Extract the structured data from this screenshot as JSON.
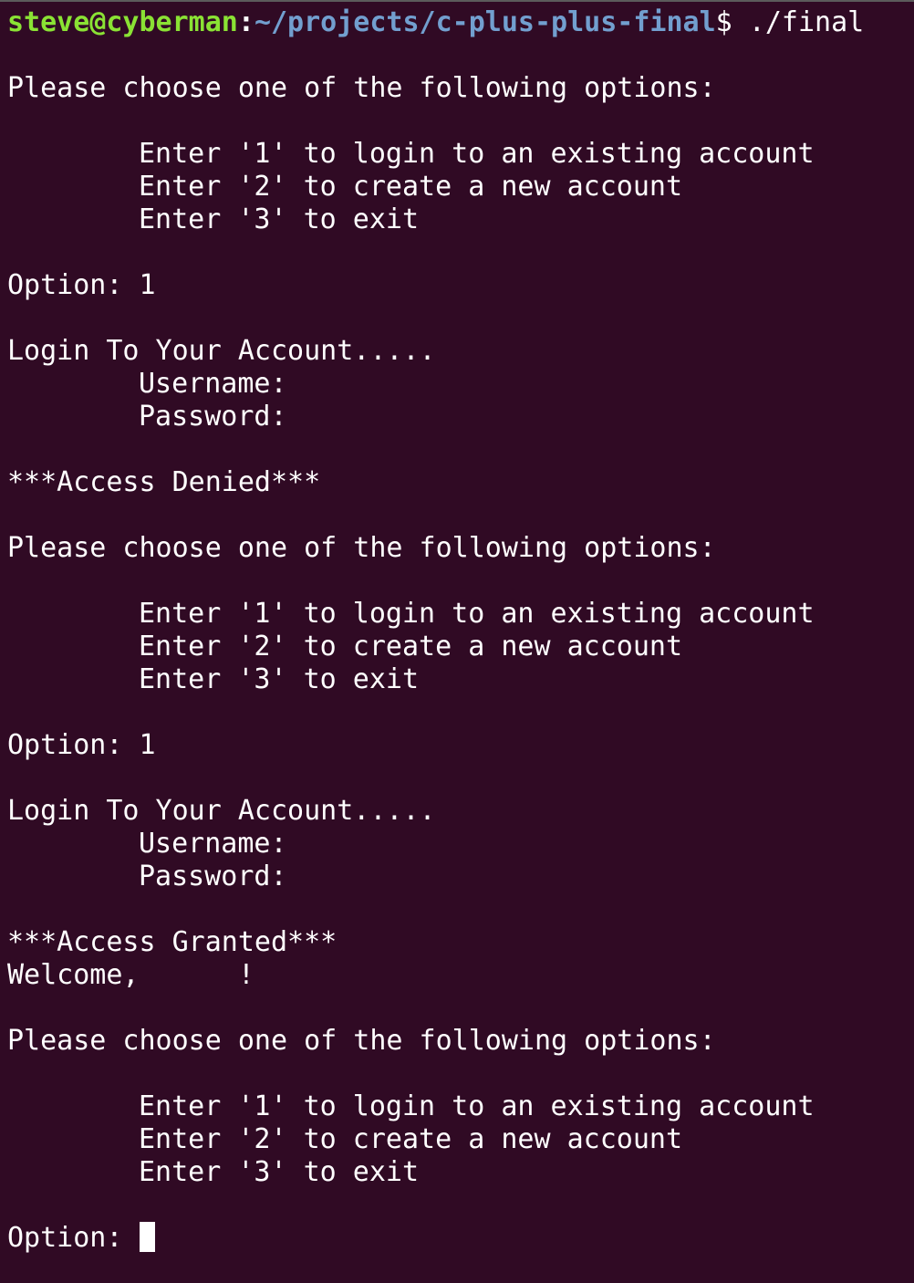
{
  "prompt": {
    "user_host": "steve@cyberman",
    "separator": ":",
    "path": "~/projects/c-plus-plus-final",
    "symbol": "$ ",
    "command": "./final"
  },
  "menu": {
    "header": "Please choose one of the following options:",
    "option1": "Enter '1' to login to an existing account",
    "option2": "Enter '2' to create a new account",
    "option3": "Enter '3' to exit"
  },
  "blocks": [
    {
      "option_line": "Option: 1"
    },
    {
      "option_line": "Option: 1"
    }
  ],
  "login": {
    "title": "Login To Your Account.....",
    "username": "Username:",
    "password": "Password:"
  },
  "results": {
    "denied": "***Access Denied***",
    "granted": "***Access Granted***",
    "welcome": "Welcome,      !"
  },
  "final_prompt": "Option: ",
  "colors": {
    "background": "#300a24",
    "user_host": "#8ae234",
    "path": "#729fcf",
    "text": "#ffffff"
  }
}
